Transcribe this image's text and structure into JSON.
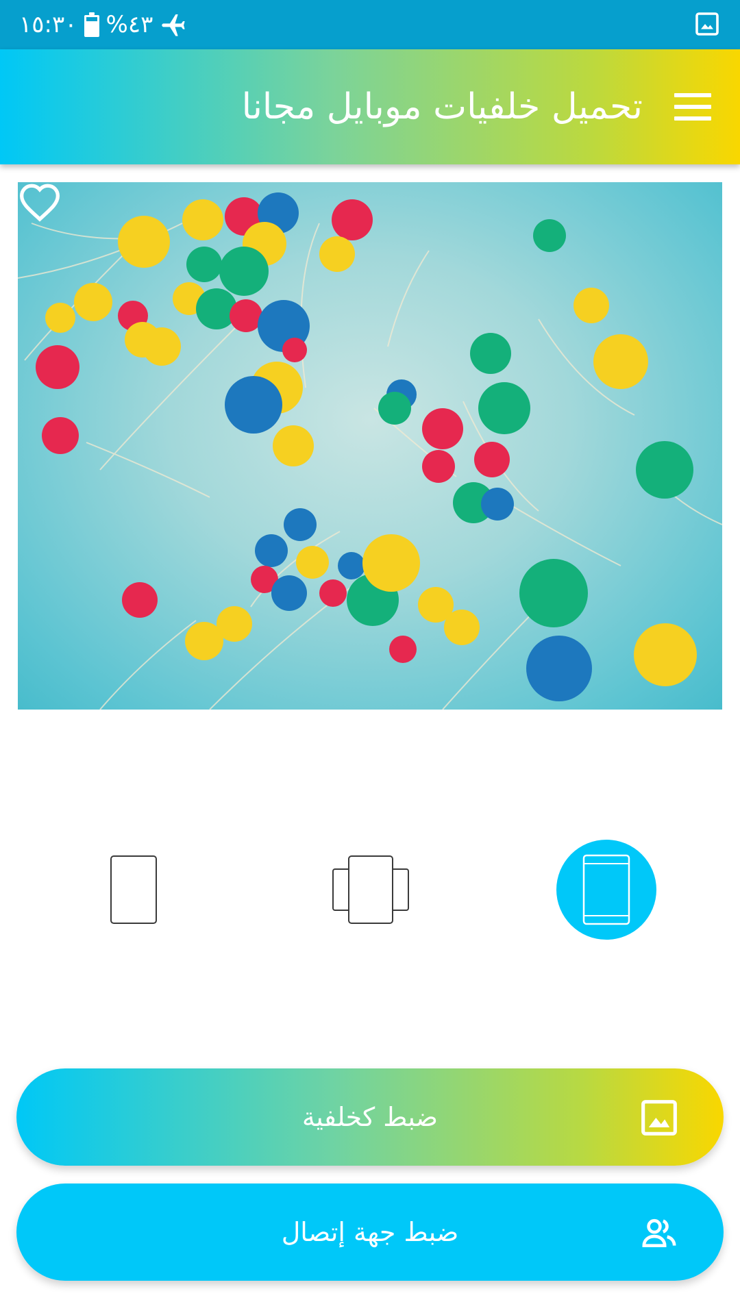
{
  "status_bar": {
    "time": "١٥:٣٠",
    "battery": "%٤٣",
    "battery_level": 0.43,
    "icons": [
      "airplane-mode-icon",
      "battery-icon",
      "gallery-notification-icon"
    ]
  },
  "app_bar": {
    "title": "تحميل خلفيات موبايل مجانا",
    "menu_icon": "hamburger-menu-icon"
  },
  "wallpaper": {
    "favorite_icon": "heart-outline-icon"
  },
  "screen_mode": {
    "selected": "home-screen",
    "options": [
      "home-screen",
      "home-and-lock-screen",
      "lock-screen"
    ]
  },
  "actions": {
    "set_wallpaper_label": "ضبط كخلفية",
    "set_wallpaper_icon": "image-icon",
    "set_contact_label": "ضبط جهة إتصال",
    "set_contact_icon": "people-icon"
  },
  "colors": {
    "status_bar": "#069fcd",
    "gradient_start": "#00c8f6",
    "gradient_end": "#f9d700",
    "accent": "#00c8f9"
  }
}
